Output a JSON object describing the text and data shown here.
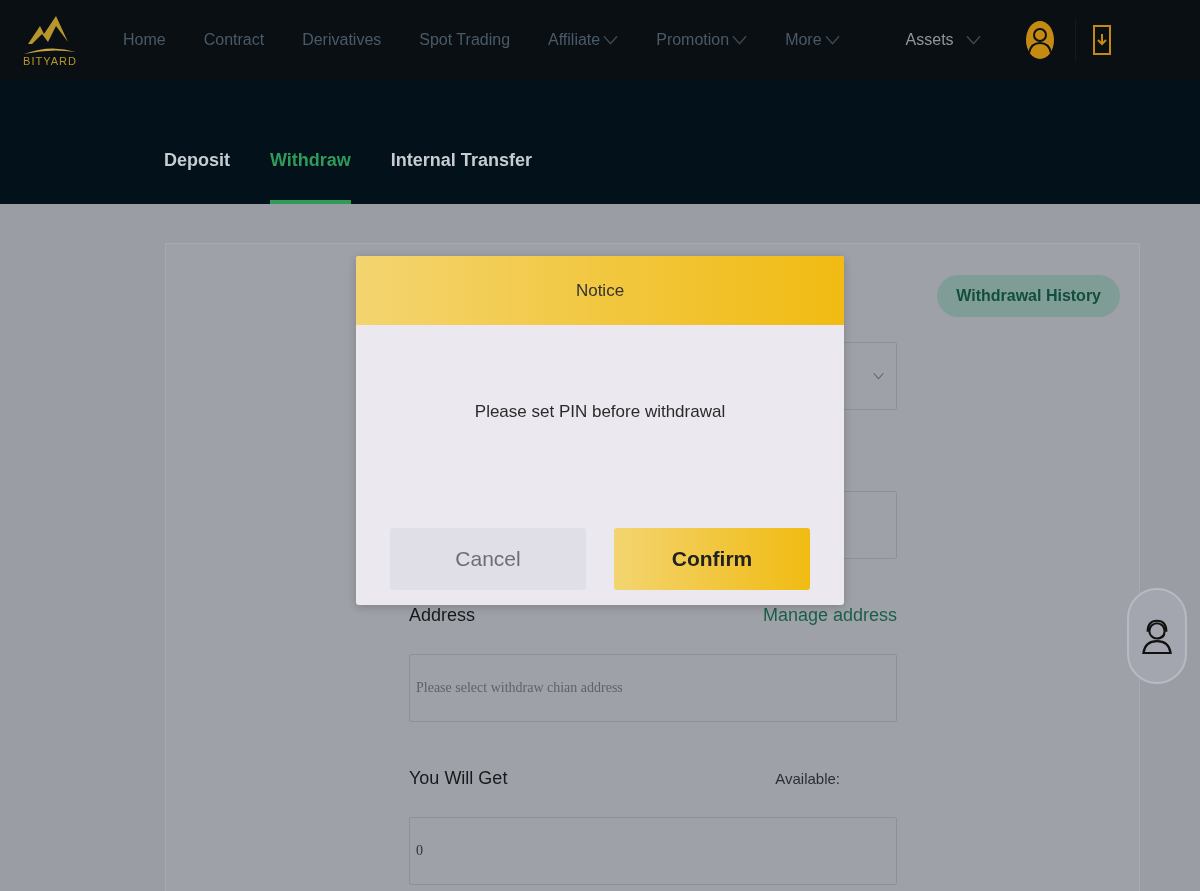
{
  "logo": {
    "text": "BITYARD"
  },
  "nav": [
    {
      "label": "Home",
      "dropdown": false
    },
    {
      "label": "Contract",
      "dropdown": false
    },
    {
      "label": "Derivatives",
      "dropdown": false
    },
    {
      "label": "Spot Trading",
      "dropdown": false
    },
    {
      "label": "Affiliate",
      "dropdown": true
    },
    {
      "label": "Promotion",
      "dropdown": true
    },
    {
      "label": "More",
      "dropdown": true
    }
  ],
  "assets": {
    "label": "Assets"
  },
  "tabs": [
    {
      "label": "Deposit",
      "selected": false
    },
    {
      "label": "Withdraw",
      "selected": true
    },
    {
      "label": "Internal Transfer",
      "selected": false
    }
  ],
  "history_button": "Withdrawal History",
  "address": {
    "label": "Address",
    "link": "Manage address",
    "placeholder": "Please select withdraw chian address"
  },
  "receive": {
    "label": "You Will Get",
    "available": "Available:",
    "value": "0"
  },
  "dialog": {
    "title": "Notice",
    "message": "Please set PIN before withdrawal",
    "buttons": [
      {
        "label": "Cancel",
        "kind": "secondary"
      },
      {
        "label": "Confirm",
        "kind": "primary"
      }
    ]
  }
}
